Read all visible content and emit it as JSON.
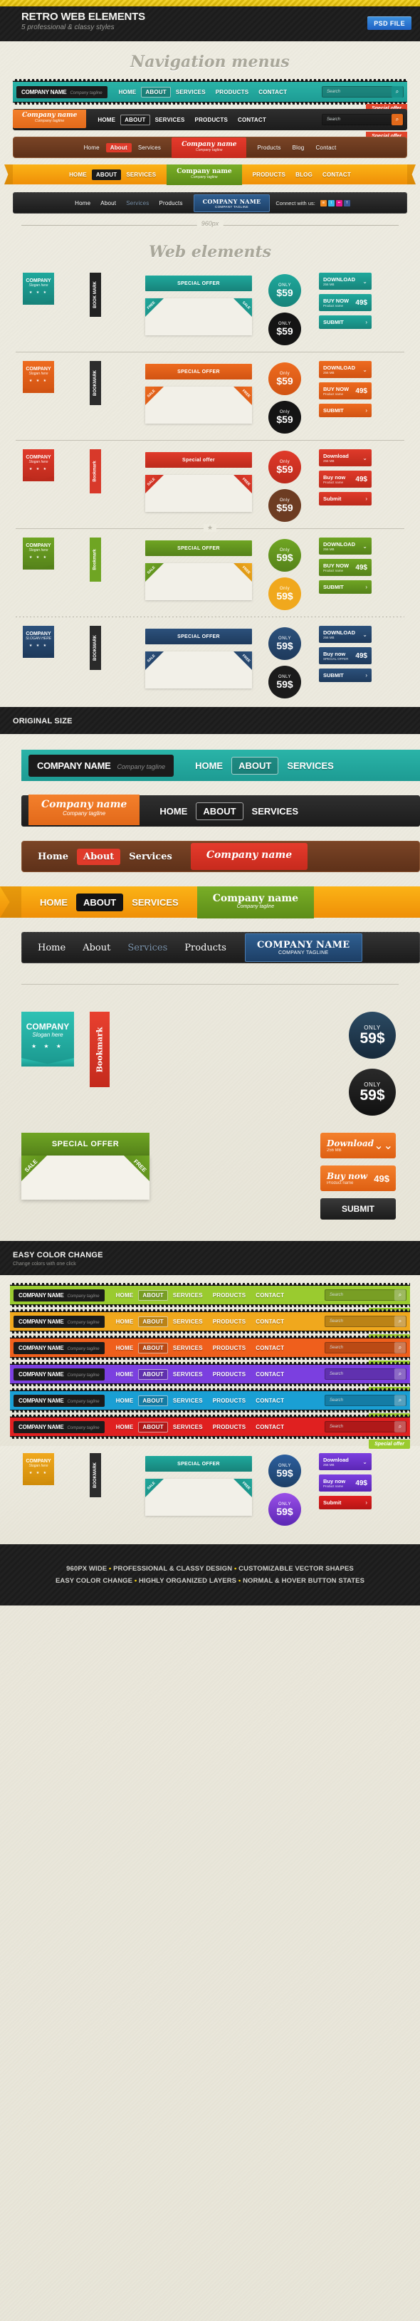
{
  "header": {
    "title": "RETRO WEB ELEMENTS",
    "subtitle": "5 professional & classy styles",
    "psd_badge": "PSD FILE",
    "accent_yellow": "#f2cf13",
    "badge_blue": "#2f7fd4"
  },
  "sections": {
    "nav_title": "Navigation menus",
    "web_title": "Web elements",
    "ruler_label": "960px",
    "original_size": {
      "title": "ORIGINAL SIZE",
      "subtitle": ""
    },
    "easy_color": {
      "title": "EASY COLOR CHANGE",
      "subtitle": "Change colors with one click"
    }
  },
  "nav_common": {
    "company_name": "COMPANY NAME",
    "company_name_mixed": "Company name",
    "tagline": "Company tagline",
    "tagline_caps": "COMPANY TAGLINE",
    "tagline_lower": "Company tagline",
    "search_placeholder": "Search",
    "search_icon": "search-icon",
    "special_offer": "Special offer",
    "connect_label": "Connect with us:",
    "links_caps": [
      "HOME",
      "ABOUT",
      "SERVICES",
      "PRODUCTS",
      "CONTACT"
    ],
    "links_mixed": [
      "Home",
      "About",
      "Services",
      "Products",
      "Blog",
      "Contact"
    ],
    "links_short": [
      "Home",
      "About",
      "Services",
      "Products"
    ],
    "links_ribbon_left": [
      "HOME",
      "ABOUT",
      "SERVICES"
    ],
    "links_ribbon_right": [
      "PRODUCTS",
      "BLOG",
      "CONTACT"
    ],
    "active": "ABOUT",
    "socials": [
      "rss-icon",
      "twitter-icon",
      "flickr-icon",
      "facebook-icon"
    ]
  },
  "nav_menus": [
    {
      "style": "teal-zigzag",
      "accent": "#1f9e95"
    },
    {
      "style": "orange-dark",
      "accent": "#ef7c1f"
    },
    {
      "style": "wood-red",
      "accent": "#6b3a1f"
    },
    {
      "style": "orange-ribbon",
      "accent": "#f0a210"
    },
    {
      "style": "denim-black",
      "accent": "#2b5581"
    }
  ],
  "web_elements": {
    "ribbon_label": "COMPANY",
    "ribbon_sub": "Slogan here",
    "ribbon_sub_caps": "SLOGAN HERE",
    "bookmark_caps": "BOOKMARK",
    "bookmark_mixed": "Bookmark",
    "bookmark_mark": "BOOK MARK",
    "special_offer_caps": "SPECIAL OFFER",
    "special_offer_mixed": "Special offer",
    "corner_free": "FREE",
    "corner_sale": "SALE",
    "badge_only": "ONLY",
    "badge_only_mixed": "Only",
    "badge_price": "$59",
    "badge_price_alt": "59$",
    "btn_download": "DOWNLOAD",
    "btn_download_mixed": "Download",
    "btn_download_sub": "256 MB",
    "btn_buynow": "BUY NOW",
    "btn_buynow_mixed": "Buy now",
    "btn_buynow_sub": "Product name",
    "btn_buynow_sub_caps": "SPECIAL OFFER",
    "btn_price": "49$",
    "btn_submit": "SUBMIT",
    "btn_submit_mixed": "Submit",
    "stars": "★ ★ ★",
    "chevron_icon": "chevron-double-down-icon",
    "arrow_icon": "chevron-right-icon"
  },
  "element_sets": [
    {
      "name": "teal",
      "primary": "#1fa89c",
      "dark": "#17837a",
      "bookmark": "#222222",
      "badge2": "#141414"
    },
    {
      "name": "orange",
      "primary": "#ee6b1f",
      "dark": "#d15312",
      "bookmark": "#2c2c2c",
      "badge2": "#141414"
    },
    {
      "name": "red",
      "primary": "#e03a2a",
      "dark": "#bc2a1c",
      "bookmark": "#d8392a",
      "badge2": "#6d3c22"
    },
    {
      "name": "green",
      "primary": "#6fa523",
      "dark": "#55821a",
      "bookmark": "#6fa523",
      "badge2": "#f0a81d"
    },
    {
      "name": "denim",
      "primary": "#2c517c",
      "dark": "#1e3a5c",
      "bookmark": "#2a2a2a",
      "badge2": "#1b1b1b"
    }
  ],
  "original_size_rows": [
    {
      "style": "teal",
      "links": [
        "HOME",
        "ABOUT",
        "SERVICES"
      ]
    },
    {
      "style": "orange",
      "links": [
        "HOME",
        "ABOUT",
        "SERVICES"
      ]
    },
    {
      "style": "wood",
      "links": [
        "Home",
        "About",
        "Services"
      ]
    },
    {
      "style": "ribbon",
      "links": [
        "HOME",
        "ABOUT",
        "SERVICES"
      ]
    },
    {
      "style": "denim",
      "links": [
        "Home",
        "About",
        "Services",
        "Products"
      ]
    }
  ],
  "color_variants": [
    {
      "name": "lime",
      "hex": "#9acb2f"
    },
    {
      "name": "amber",
      "hex": "#f0a81d"
    },
    {
      "name": "orange",
      "hex": "#ef5f1c"
    },
    {
      "name": "violet",
      "hex": "#7b3fe0"
    },
    {
      "name": "azure",
      "hex": "#1a9fd4"
    },
    {
      "name": "crimson",
      "hex": "#e02020"
    }
  ],
  "footer": {
    "line1": [
      "960PX WIDE",
      "PROFESSIONAL & CLASSY DESIGN",
      "CUSTOMIZABLE VECTOR SHAPES"
    ],
    "line2": [
      "EASY COLOR CHANGE",
      "HIGHLY ORGANIZED LAYERS",
      "NORMAL & HOVER BUTTON STATES"
    ],
    "separator": "•"
  }
}
